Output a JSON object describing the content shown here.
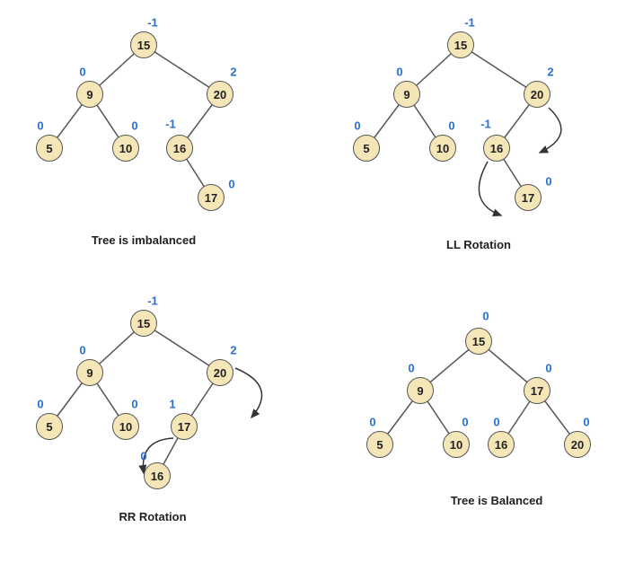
{
  "panels": {
    "p1": {
      "caption": "Tree is imbalanced",
      "nodes": {
        "n15": {
          "v": "15",
          "bf": "-1"
        },
        "n9": {
          "v": "9",
          "bf": "0"
        },
        "n20": {
          "v": "20",
          "bf": "2"
        },
        "n5": {
          "v": "5",
          "bf": "0"
        },
        "n10": {
          "v": "10",
          "bf": "0"
        },
        "n16": {
          "v": "16",
          "bf": "-1"
        },
        "n17": {
          "v": "17",
          "bf": "0"
        }
      }
    },
    "p2": {
      "caption": "LL Rotation",
      "nodes": {
        "n15": {
          "v": "15",
          "bf": "-1"
        },
        "n9": {
          "v": "9",
          "bf": "0"
        },
        "n20": {
          "v": "20",
          "bf": "2"
        },
        "n5": {
          "v": "5",
          "bf": "0"
        },
        "n10": {
          "v": "10",
          "bf": "0"
        },
        "n16": {
          "v": "16",
          "bf": "-1"
        },
        "n17": {
          "v": "17",
          "bf": "0"
        }
      }
    },
    "p3": {
      "caption": "RR Rotation",
      "nodes": {
        "n15": {
          "v": "15",
          "bf": "-1"
        },
        "n9": {
          "v": "9",
          "bf": "0"
        },
        "n20": {
          "v": "20",
          "bf": "2"
        },
        "n5": {
          "v": "5",
          "bf": "0"
        },
        "n10": {
          "v": "10",
          "bf": "0"
        },
        "n17": {
          "v": "17",
          "bf": "1"
        },
        "n16": {
          "v": "16",
          "bf": "0"
        }
      }
    },
    "p4": {
      "caption": "Tree is Balanced",
      "nodes": {
        "n15": {
          "v": "15",
          "bf": "0"
        },
        "n9": {
          "v": "9",
          "bf": "0"
        },
        "n17": {
          "v": "17",
          "bf": "0"
        },
        "n5": {
          "v": "5",
          "bf": "0"
        },
        "n10": {
          "v": "10",
          "bf": "0"
        },
        "n16": {
          "v": "16",
          "bf": "0"
        },
        "n20": {
          "v": "20",
          "bf": "0"
        }
      }
    }
  }
}
